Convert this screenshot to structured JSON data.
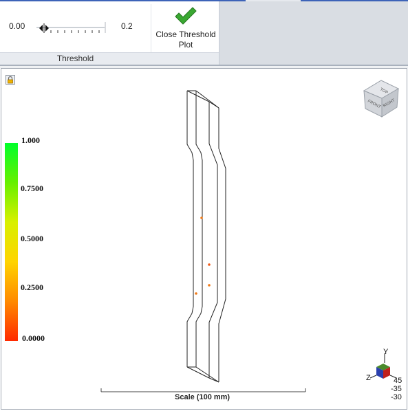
{
  "ribbon": {
    "threshold": {
      "min_value": "0.00",
      "max_value": "0.2",
      "slider_position": 0.05,
      "group_label": "Threshold"
    },
    "close_button": {
      "label": "Close Threshold Plot",
      "icon": "checkmark-icon",
      "icon_color": "#3aa832"
    }
  },
  "viewport": {
    "legend": {
      "labels": [
        "1.000",
        "0.7500",
        "0.5000",
        "0.2500",
        "0.0000"
      ],
      "top_color": "#00ff2a",
      "bottom_color": "#ff2a00"
    },
    "view_cube": {
      "faces": [
        "TOP",
        "FRONT",
        "RIGHT"
      ]
    },
    "scale_label": "Scale (100 mm)",
    "triad": {
      "y_label": "Y",
      "z_label": "Z",
      "readouts": [
        "45",
        "-35",
        "-30"
      ]
    },
    "marker_color": "#f07a18",
    "lock_icon": "lock-icon"
  }
}
